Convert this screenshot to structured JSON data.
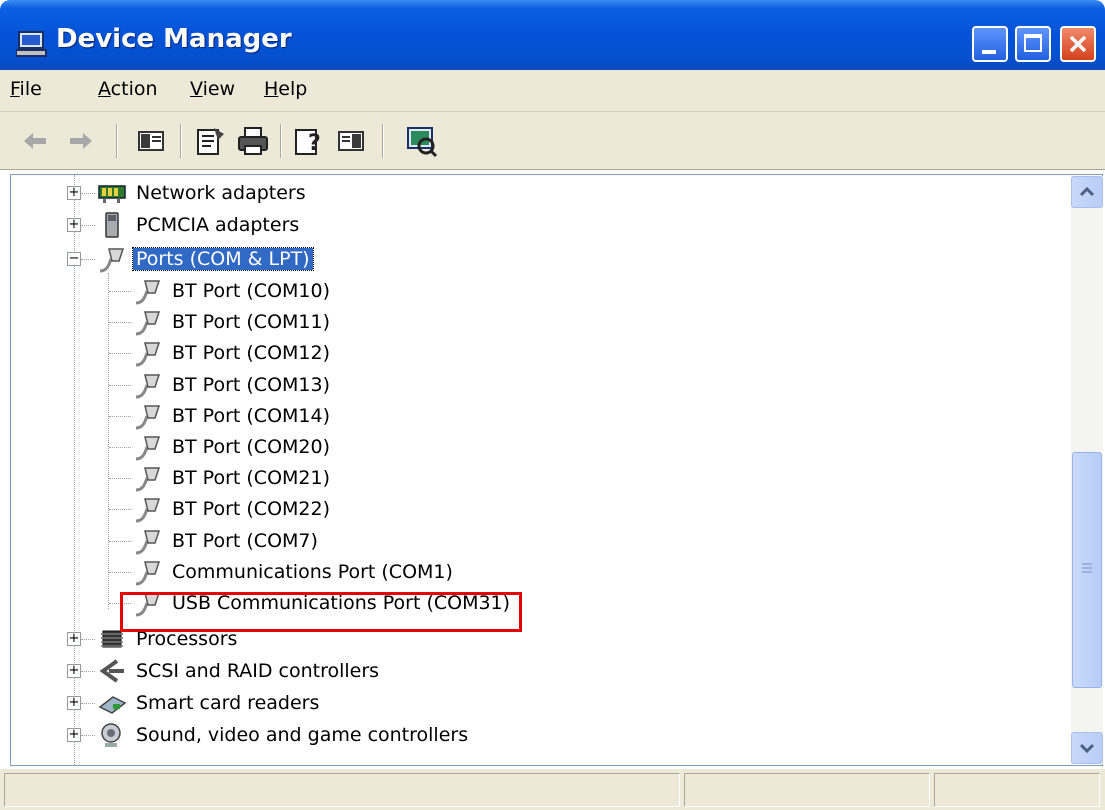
{
  "window": {
    "title": "Device Manager",
    "icon": "computer-monitor-icon"
  },
  "menu": {
    "items": [
      {
        "label": "File",
        "accel": "F",
        "rest": "ile"
      },
      {
        "label": "Action",
        "accel": "A",
        "rest": "ction"
      },
      {
        "label": "View",
        "accel": "V",
        "rest": "iew"
      },
      {
        "label": "Help",
        "accel": "H",
        "rest": "elp"
      }
    ]
  },
  "toolbar": {
    "buttons": [
      "back-arrow-icon",
      "forward-arrow-icon",
      "show-hide-console-tree-icon",
      "properties-icon",
      "print-icon",
      "help-icon",
      "show-hide-action-pane-icon",
      "scan-hardware-changes-icon"
    ]
  },
  "tree": {
    "categories_top": [
      {
        "label": "Network adapters",
        "icon": "network-adapter-icon",
        "expander": "+"
      },
      {
        "label": "PCMCIA adapters",
        "icon": "pcmcia-card-icon",
        "expander": "+"
      },
      {
        "label": "Ports (COM & LPT)",
        "icon": "serial-port-icon",
        "expander": "−",
        "selected": true
      }
    ],
    "ports": [
      {
        "label": "BT Port (COM10)"
      },
      {
        "label": "BT Port (COM11)"
      },
      {
        "label": "BT Port (COM12)"
      },
      {
        "label": "BT Port (COM13)"
      },
      {
        "label": "BT Port (COM14)"
      },
      {
        "label": "BT Port (COM20)"
      },
      {
        "label": "BT Port (COM21)"
      },
      {
        "label": "BT Port (COM22)"
      },
      {
        "label": "BT Port (COM7)"
      },
      {
        "label": "Communications Port (COM1)"
      },
      {
        "label": "USB Communications Port (COM31)",
        "highlighted": true
      }
    ],
    "categories_bottom": [
      {
        "label": "Processors",
        "icon": "processor-chip-icon",
        "expander": "+"
      },
      {
        "label": "SCSI and RAID controllers",
        "icon": "scsi-controller-icon",
        "expander": "+"
      },
      {
        "label": "Smart card readers",
        "icon": "smart-card-reader-icon",
        "expander": "+"
      },
      {
        "label": "Sound, video and game controllers",
        "icon": "speaker-icon",
        "expander": "+"
      }
    ]
  },
  "colors": {
    "titlebar": "#0553d8",
    "selection": "#316ac5",
    "highlight_border": "#e60000",
    "chrome": "#ece9d8"
  }
}
